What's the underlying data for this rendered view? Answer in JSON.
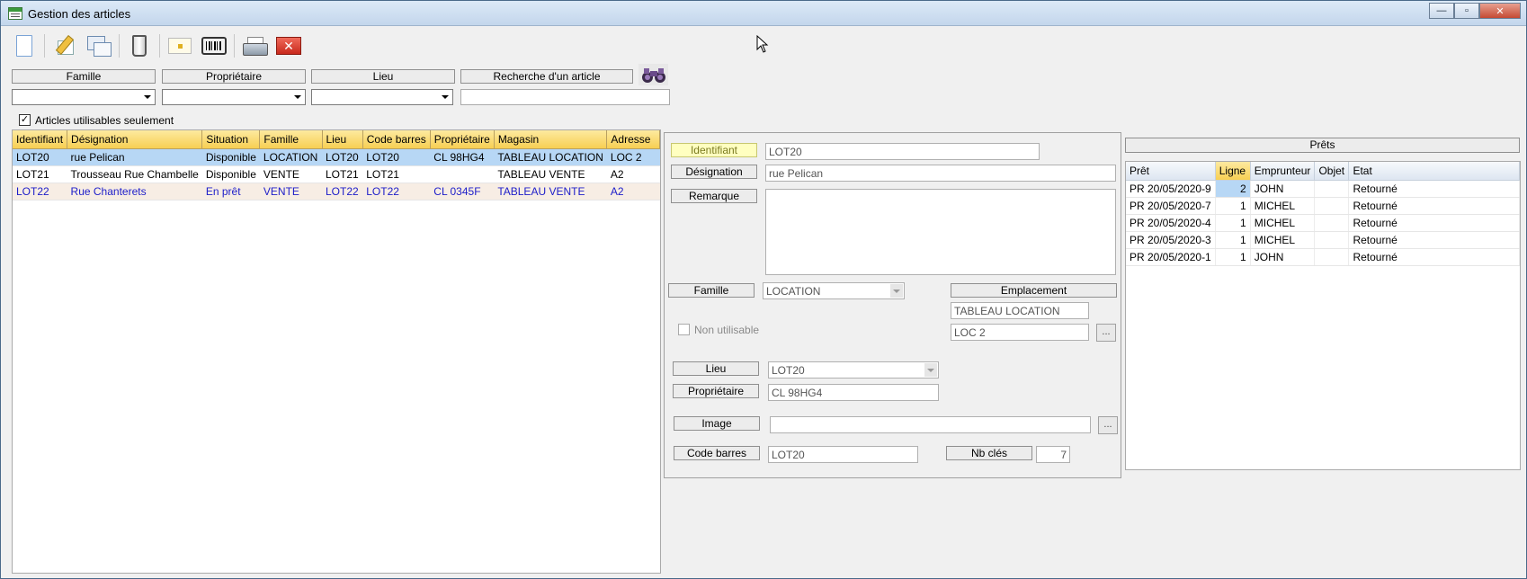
{
  "window": {
    "title": "Gestion des articles"
  },
  "filters": {
    "famille_label": "Famille",
    "proprietaire_label": "Propriétaire",
    "lieu_label": "Lieu",
    "search_label": "Recherche d'un article",
    "famille_value": "",
    "proprietaire_value": "",
    "lieu_value": "",
    "search_value": ""
  },
  "usable_only": {
    "label": "Articles utilisables seulement",
    "checked": "✓"
  },
  "articles": {
    "columns": [
      "Identifiant",
      "Désignation",
      "Situation",
      "Famille",
      "Lieu",
      "Code barres",
      "Propriétaire",
      "Magasin",
      "Adresse"
    ],
    "rows": [
      [
        "LOT20",
        "rue Pelican",
        "Disponible",
        "LOCATION",
        "LOT20",
        "LOT20",
        "CL 98HG4",
        "TABLEAU LOCATION",
        "LOC 2"
      ],
      [
        "LOT21",
        "Trousseau Rue Chambelle",
        "Disponible",
        "VENTE",
        "LOT21",
        "LOT21",
        "",
        "TABLEAU VENTE",
        "A2"
      ],
      [
        "LOT22",
        "Rue Chanterets",
        "En prêt",
        "VENTE",
        "LOT22",
        "LOT22",
        "CL 0345F",
        "TABLEAU VENTE",
        "A2"
      ]
    ]
  },
  "detail": {
    "identifiant_label": "Identifiant",
    "identifiant_value": "LOT20",
    "designation_label": "Désignation",
    "designation_value": "rue Pelican",
    "remarque_label": "Remarque",
    "remarque_value": "",
    "famille_label": "Famille",
    "famille_value": "LOCATION",
    "emplacement_label": "Emplacement",
    "magasin_value": "TABLEAU LOCATION",
    "adresse_value": "LOC 2",
    "non_utilisable_label": "Non utilisable",
    "lieu_label": "Lieu",
    "lieu_value": "LOT20",
    "proprietaire_label": "Propriétaire",
    "proprietaire_value": "CL 98HG4",
    "image_label": "Image",
    "image_value": "",
    "code_barres_label": "Code barres",
    "code_barres_value": "LOT20",
    "nb_cles_label": "Nb clés",
    "nb_cles_value": "7",
    "browse_label": "..."
  },
  "loans": {
    "title": "Prêts",
    "columns": [
      "Prêt",
      "Ligne",
      "Emprunteur",
      "Objet",
      "Etat"
    ],
    "rows": [
      [
        "PR 20/05/2020-9",
        "2",
        "JOHN",
        "",
        "Retourné"
      ],
      [
        "PR 20/05/2020-7",
        "1",
        "MICHEL",
        "",
        "Retourné"
      ],
      [
        "PR 20/05/2020-4",
        "1",
        "MICHEL",
        "",
        "Retourné"
      ],
      [
        "PR 20/05/2020-3",
        "1",
        "MICHEL",
        "",
        "Retourné"
      ],
      [
        "PR 20/05/2020-1",
        "1",
        "JOHN",
        "",
        "Retourné"
      ]
    ]
  },
  "toolbar": {
    "icons": [
      "new-document-icon",
      "edit-icon",
      "duplicate-icon",
      "delete-icon",
      "card-icon",
      "barcode-icon",
      "print-icon",
      "close-icon"
    ],
    "close_glyph": "✕"
  },
  "titlebar": {
    "minimize": "—",
    "maximize": "▫",
    "close": "✕"
  }
}
